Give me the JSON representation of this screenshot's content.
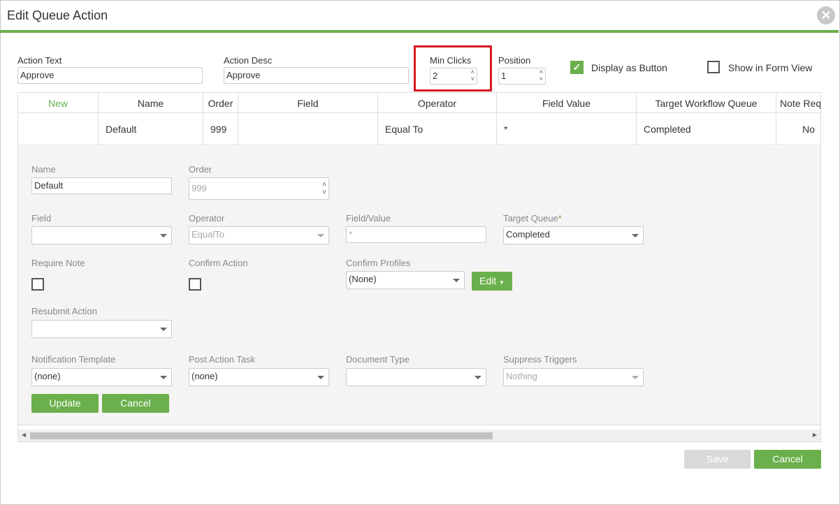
{
  "dialog": {
    "title": "Edit Queue Action"
  },
  "top": {
    "action_text_label": "Action Text",
    "action_text_value": "Approve",
    "action_desc_label": "Action Desc",
    "action_desc_value": "Approve",
    "min_clicks_label": "Min Clicks",
    "min_clicks_value": "2",
    "position_label": "Position",
    "position_value": "1",
    "display_as_button_label": "Display as Button",
    "display_as_button_checked": true,
    "show_in_form_view_label": "Show in Form View",
    "show_in_form_view_checked": false
  },
  "grid": {
    "headers": [
      "New",
      "Name",
      "Order",
      "Field",
      "Operator",
      "Field Value",
      "Target Workflow Queue",
      "Note Req"
    ],
    "row": {
      "name": "Default",
      "order": "999",
      "field": "",
      "operator": "Equal To",
      "field_value": "*",
      "target_queue": "Completed",
      "note_req": "No"
    }
  },
  "edit": {
    "name_label": "Name",
    "name_value": "Default",
    "order_label": "Order",
    "order_value": "999",
    "field_label": "Field",
    "field_value": "",
    "operator_label": "Operator",
    "operator_value": "EqualTo",
    "fieldvalue_label": "Field/Value",
    "fieldvalue_placeholder": "*",
    "target_queue_label": "Target Queue",
    "target_queue_required": "*",
    "target_queue_value": "Completed",
    "require_note_label": "Require Note",
    "confirm_action_label": "Confirm Action",
    "confirm_profiles_label": "Confirm Profiles",
    "confirm_profiles_value": "(None)",
    "edit_button": "Edit",
    "resubmit_label": "Resubmit Action",
    "resubmit_value": "",
    "notif_label": "Notification Template",
    "notif_value": "(none)",
    "post_action_label": "Post Action Task",
    "post_action_value": "(none)",
    "doc_type_label": "Document Type",
    "doc_type_value": "",
    "suppress_label": "Suppress Triggers",
    "suppress_value": "Nothing",
    "update_button": "Update",
    "cancel_button": "Cancel"
  },
  "footer": {
    "save_button": "Save",
    "cancel_button": "Cancel"
  },
  "colors": {
    "accent": "#6ab04c",
    "highlight": "#d9191f"
  }
}
